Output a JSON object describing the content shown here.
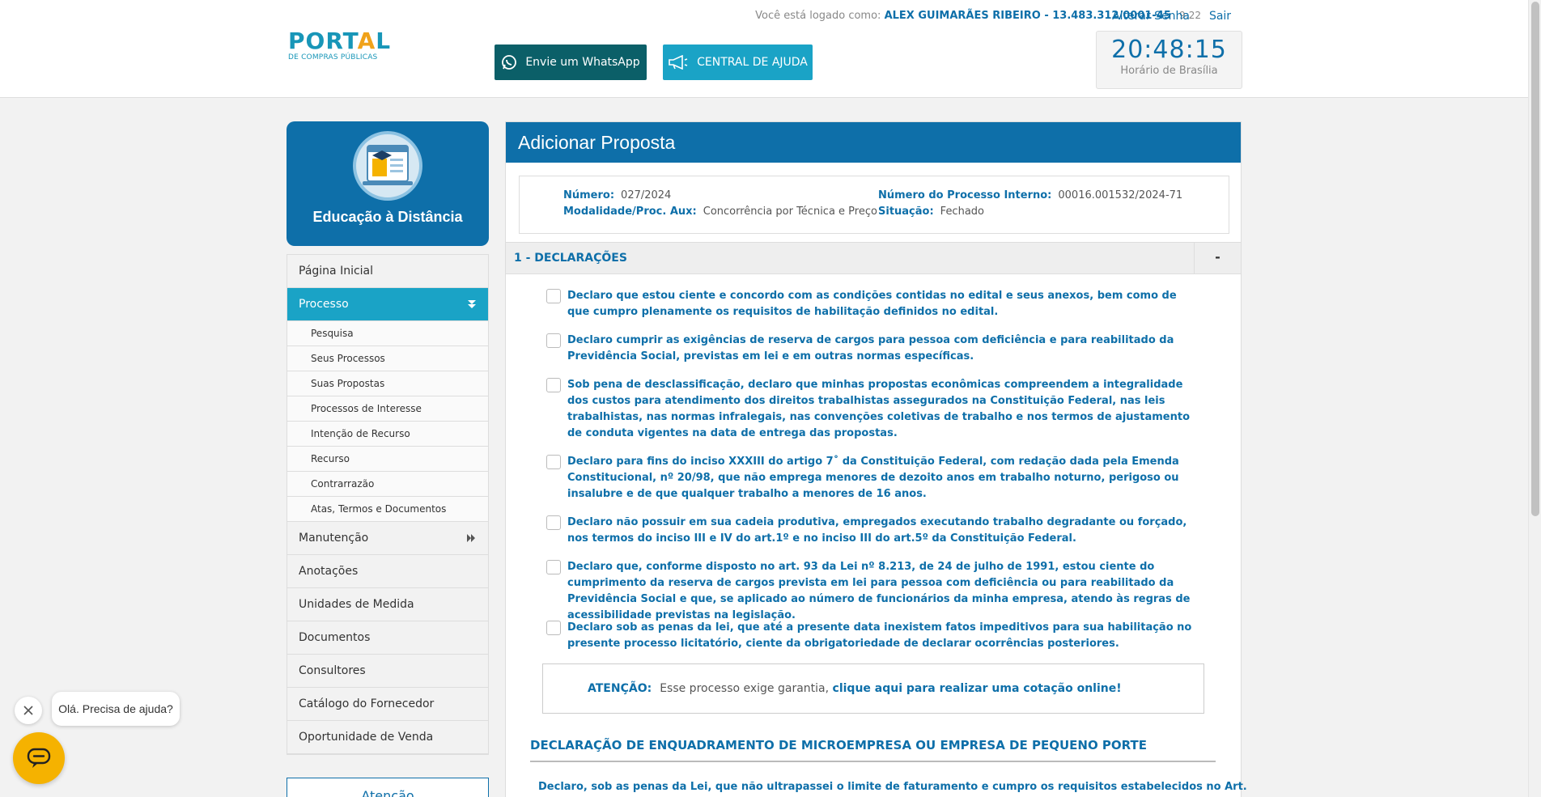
{
  "header": {
    "logo_main": "PORT",
    "logo_accent": "A",
    "logo_end": "L",
    "logo_sub": "DE COMPRAS PÚBLICAS",
    "logged_prefix": "Você está logado como:",
    "user_name": "ALEX GUIMARÃES RIBEIRO - 13.483.312/0001-45",
    "session_time": "9:22",
    "change_password": "Alterar Senha",
    "logout": "Sair",
    "whatsapp_label": "Envie um WhatsApp",
    "help_label": "CENTRAL DE AJUDA",
    "clock_time": "20:48:15",
    "clock_zone": "Horário de Brasília"
  },
  "sidebar": {
    "edu_label": "Educação à Distância",
    "items": [
      {
        "label": "Página Inicial"
      },
      {
        "label": "Processo"
      },
      {
        "label": "Manutenção"
      },
      {
        "label": "Anotações"
      },
      {
        "label": "Unidades de Medida"
      },
      {
        "label": "Documentos"
      },
      {
        "label": "Consultores"
      },
      {
        "label": "Catálogo do Fornecedor"
      },
      {
        "label": "Oportunidade de Venda"
      }
    ],
    "sub_items": [
      {
        "label": "Pesquisa"
      },
      {
        "label": "Seus Processos"
      },
      {
        "label": "Suas Propostas"
      },
      {
        "label": "Processos de Interesse"
      },
      {
        "label": "Intenção de Recurso"
      },
      {
        "label": "Recurso"
      },
      {
        "label": "Contrarrazão"
      },
      {
        "label": "Atas, Termos e Documentos"
      }
    ],
    "attention_box": "Atenção"
  },
  "main": {
    "title": "Adicionar Proposta",
    "info": {
      "numero_label": "Número:",
      "numero_value": "027/2024",
      "modalidade_label": "Modalidade/Proc. Aux:",
      "modalidade_value": "Concorrência por Técnica e Preço",
      "processo_label": "Número do Processo Interno:",
      "processo_value": "00016.001532/2024-71",
      "situacao_label": "Situação:",
      "situacao_value": "Fechado"
    },
    "section_title": "1 - DECLARAÇÕES",
    "section_toggle": "-",
    "declarations": [
      {
        "text": "Declaro que estou ciente e concordo com as condições contidas no edital e seus anexos, bem como de que cumpro plenamente os requisitos de habilitação definidos no edital."
      },
      {
        "text": "Declaro cumprir as exigências de reserva de cargos para pessoa com deficiência e para reabilitado da Previdência Social, previstas em lei e em outras normas específicas."
      },
      {
        "text": "Sob pena de desclassificação, declaro que minhas propostas econômicas compreendem a integralidade dos custos para atendimento dos direitos trabalhistas assegurados na Constituição Federal, nas leis trabalhistas, nas normas infralegais, nas convenções coletivas de trabalho e nos termos de ajustamento de conduta vigentes na data de entrega das propostas."
      },
      {
        "text": "Declaro para fins do inciso XXXIII do artigo 7˚ da Constituição Federal, com redação dada pela Emenda Constitucional, nº 20/98, que não emprega menores de dezoito anos em trabalho noturno, perigoso ou insalubre e de que qualquer trabalho a menores de 16 anos."
      },
      {
        "text": "Declaro não possuir em sua cadeia produtiva, empregados executando trabalho degradante ou forçado, nos termos do inciso III e IV do art.1º e no inciso III do art.5º da Constituição Federal."
      },
      {
        "text": "Declaro que, conforme disposto no art. 93 da Lei nº 8.213, de 24 de julho de 1991, estou ciente do cumprimento da reserva de cargos prevista em lei para pessoa com deficiência ou para reabilitado da Previdência Social e que, se aplicado ao número de funcionários da minha empresa, atendo às regras de acessibilidade previstas na legislação."
      },
      {
        "text": "Declaro sob as penas da lei, que até a presente data inexistem fatos impeditivos para sua habilitação no presente processo licitatório, ciente da obrigatoriedade de declarar ocorrências posteriores."
      }
    ],
    "warning": {
      "label": "ATENÇÃO:",
      "text": "Esse processo exige garantia,",
      "link": "clique aqui para realizar uma cotação online!"
    },
    "me_title": "DECLARAÇÃO DE ENQUADRAMENTO DE MICROEMPRESA OU EMPRESA DE PEQUENO PORTE",
    "me_text": "Declaro, sob as penas da Lei, que não ultrapassei o limite de faturamento e cumpro os requisitos estabelecidos no Art."
  },
  "chat": {
    "greeting": "Olá. Precisa de ajuda?"
  },
  "colors": {
    "primary": "#0e6fa9",
    "accent": "#1aa3c6",
    "whatsapp": "#0b5f68",
    "chat": "#f5b200"
  }
}
